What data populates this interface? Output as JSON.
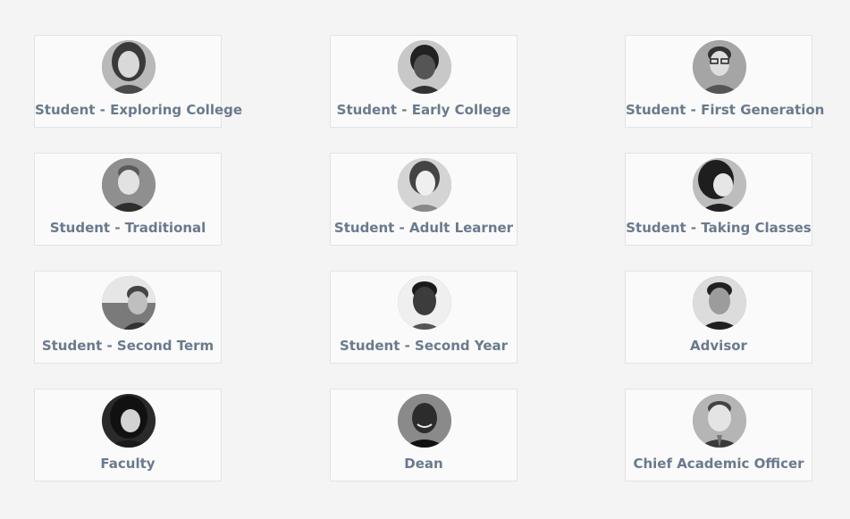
{
  "personas": [
    {
      "label": "Student - Exploring College",
      "avatar_icon": "woman-portrait-icon"
    },
    {
      "label": "Student - Early College",
      "avatar_icon": "girl-portrait-icon"
    },
    {
      "label": "Student - First Generation",
      "avatar_icon": "man-with-glasses-portrait-icon"
    },
    {
      "label": "Student - Traditional",
      "avatar_icon": "young-man-portrait-icon"
    },
    {
      "label": "Student - Adult Learner",
      "avatar_icon": "woman-portrait-icon"
    },
    {
      "label": "Student - Taking Classes",
      "avatar_icon": "smiling-woman-portrait-icon"
    },
    {
      "label": "Student - Second Term",
      "avatar_icon": "man-selfie-portrait-icon"
    },
    {
      "label": "Student - Second Year",
      "avatar_icon": "woman-short-hair-portrait-icon"
    },
    {
      "label": "Advisor",
      "avatar_icon": "man-portrait-icon"
    },
    {
      "label": "Faculty",
      "avatar_icon": "woman-long-hair-portrait-icon"
    },
    {
      "label": "Dean",
      "avatar_icon": "man-smiling-portrait-icon"
    },
    {
      "label": "Chief Academic Officer",
      "avatar_icon": "man-suit-portrait-icon"
    }
  ]
}
